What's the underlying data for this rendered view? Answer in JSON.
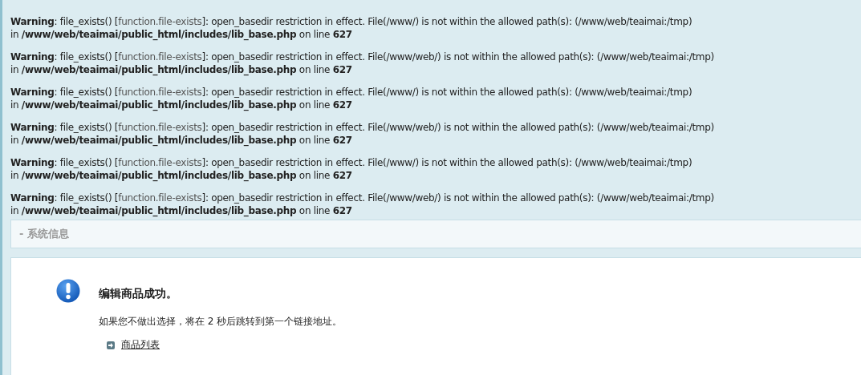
{
  "warnings": [
    {
      "before": "**Warning**: file_exists() [",
      "link": "function.file-exists",
      "after": "]: open_basedir restriction in effect. File(/www/) is not within the allowed path(s): (/www/web/teaimai:/tmp)",
      "location": "in **/www/web/teaimai/public_html/includes/lib_base.php** on line **627**"
    },
    {
      "before": "**Warning**: file_exists() [",
      "link": "function.file-exists",
      "after": "]: open_basedir restriction in effect. File(/www/web/) is not within the allowed path(s): (/www/web/teaimai:/tmp)",
      "location": "in **/www/web/teaimai/public_html/includes/lib_base.php** on line **627**"
    },
    {
      "before": "**Warning**: file_exists() [",
      "link": "function.file-exists",
      "after": "]: open_basedir restriction in effect. File(/www/) is not within the allowed path(s): (/www/web/teaimai:/tmp)",
      "location": "in **/www/web/teaimai/public_html/includes/lib_base.php** on line **627**"
    },
    {
      "before": "**Warning**: file_exists() [",
      "link": "function.file-exists",
      "after": "]: open_basedir restriction in effect. File(/www/web/) is not within the allowed path(s): (/www/web/teaimai:/tmp)",
      "location": "in **/www/web/teaimai/public_html/includes/lib_base.php** on line **627**"
    },
    {
      "before": "**Warning**: file_exists() [",
      "link": "function.file-exists",
      "after": "]: open_basedir restriction in effect. File(/www/) is not within the allowed path(s): (/www/web/teaimai:/tmp)",
      "location": "in **/www/web/teaimai/public_html/includes/lib_base.php** on line **627**"
    },
    {
      "before": "**Warning**: file_exists() [",
      "link": "function.file-exists",
      "after": "]: open_basedir restriction in effect. File(/www/web/) is not within the allowed path(s): (/www/web/teaimai:/tmp)",
      "location": "in **/www/web/teaimai/public_html/includes/lib_base.php** on line **627**"
    }
  ],
  "panel_header": "- 系统信息",
  "message": {
    "title": "编辑商品成功。",
    "text": "如果您不做出选择，将在 2 秒后跳转到第一个链接地址。",
    "links": [
      "商品列表"
    ]
  }
}
